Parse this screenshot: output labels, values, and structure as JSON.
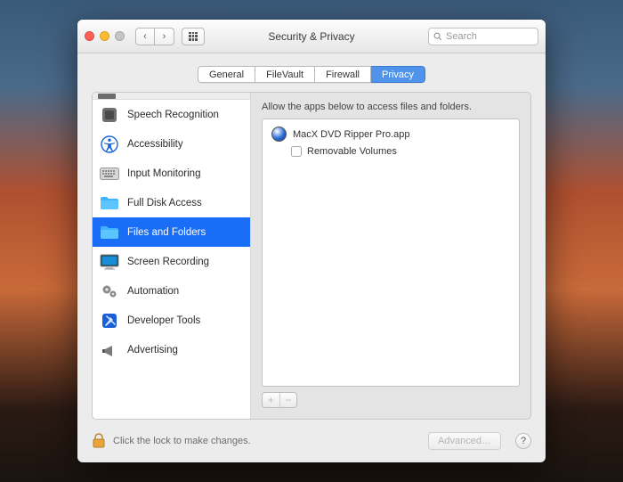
{
  "window": {
    "title": "Security & Privacy"
  },
  "search": {
    "placeholder": "Search"
  },
  "tabs": [
    {
      "label": "General"
    },
    {
      "label": "FileVault"
    },
    {
      "label": "Firewall"
    },
    {
      "label": "Privacy",
      "active": true
    }
  ],
  "sidebar": {
    "items": [
      {
        "label": "Speech Recognition",
        "icon": "speech"
      },
      {
        "label": "Accessibility",
        "icon": "accessibility"
      },
      {
        "label": "Input Monitoring",
        "icon": "keyboard"
      },
      {
        "label": "Full Disk Access",
        "icon": "disk"
      },
      {
        "label": "Files and Folders",
        "icon": "folder",
        "selected": true
      },
      {
        "label": "Screen Recording",
        "icon": "screen"
      },
      {
        "label": "Automation",
        "icon": "gears"
      },
      {
        "label": "Developer Tools",
        "icon": "hammer"
      },
      {
        "label": "Advertising",
        "icon": "megaphone"
      }
    ]
  },
  "main": {
    "hint": "Allow the apps below to access files and folders.",
    "app": {
      "name": "MacX DVD Ripper Pro.app"
    },
    "permission": {
      "label": "Removable Volumes",
      "checked": false
    }
  },
  "footer": {
    "lock_text": "Click the lock to make changes.",
    "advanced": "Advanced…",
    "help": "?"
  }
}
